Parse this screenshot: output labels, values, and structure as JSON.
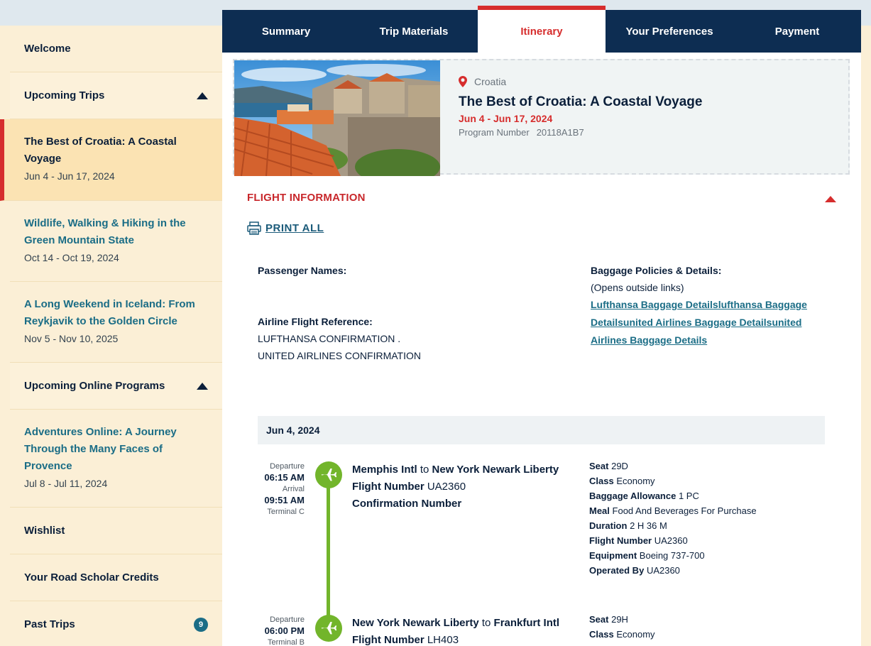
{
  "sidebar": {
    "welcome": "Welcome",
    "upcoming_trips": "Upcoming Trips",
    "trips": [
      {
        "title": "The Best of Croatia: A Coastal Voyage",
        "dates": "Jun 4 - Jun 17, 2024"
      },
      {
        "title": "Wildlife, Walking & Hiking in the Green Mountain State",
        "dates": "Oct 14 - Oct 19, 2024"
      },
      {
        "title": "A Long Weekend in Iceland: From Reykjavik to the Golden Circle",
        "dates": "Nov 5 - Nov 10, 2025"
      }
    ],
    "upcoming_online": "Upcoming Online Programs",
    "online": [
      {
        "title": "Adventures Online: A Journey Through the Many Faces of Provence",
        "dates": "Jul 8 - Jul 11, 2024"
      }
    ],
    "wishlist": "Wishlist",
    "credits": "Your Road Scholar Credits",
    "past_trips": "Past Trips",
    "past_count": "9"
  },
  "tabs": [
    "Summary",
    "Trip Materials",
    "Itinerary",
    "Your Preferences",
    "Payment"
  ],
  "card": {
    "location": "Croatia",
    "title": "The Best of Croatia: A Coastal Voyage",
    "dates": "Jun 4 - Jun 17, 2024",
    "program_label": "Program Number",
    "program_number": "20118A1B7"
  },
  "flight": {
    "heading": "FLIGHT INFORMATION",
    "print_all": "PRINT ALL",
    "passenger_label": "Passenger Names:",
    "reference_label": "Airline Flight Reference:",
    "references": [
      "LUFTHANSA CONFIRMATION .",
      "UNITED AIRLINES CONFIRMATION"
    ],
    "baggage_label": "Baggage Policies & Details:",
    "baggage_note": "(Opens outside links)",
    "baggage_link": "Lufthansa Baggage Detailslufthansa Baggage Detailsunited Airlines Baggage Detailsunited Airlines Baggage Details",
    "day": "Jun 4, 2024",
    "segments": [
      {
        "departure_label": "Departure",
        "departure_time": "06:15 AM",
        "arrival_label": "Arrival",
        "arrival_time": "09:51 AM",
        "terminal": "Terminal C",
        "from": "Memphis Intl",
        "to_word": "to",
        "to": "New York Newark Liberty",
        "flight_number_label": "Flight Number",
        "flight_number": "UA2360",
        "confirmation_label": "Confirmation Number",
        "seat_label": "Seat",
        "seat": "29D",
        "class_label": "Class",
        "class": "Economy",
        "baggage_label": "Baggage Allowance",
        "baggage": "1 PC",
        "meal_label": "Meal",
        "meal": "Food And Beverages For Purchase",
        "duration_label": "Duration",
        "duration": "2 H 36 M",
        "fn_label": "Flight Number",
        "fn": "UA2360",
        "equipment_label": "Equipment",
        "equipment": "Boeing 737-700",
        "operated_label": "Operated By",
        "operated": "UA2360"
      },
      {
        "departure_label": "Departure",
        "departure_time": "06:00 PM",
        "terminal": "Terminal B",
        "from": "New York Newark Liberty",
        "to_word": "to",
        "to": "Frankfurt Intl",
        "flight_number_label": "Flight Number",
        "flight_number": "LH403",
        "seat_label": "Seat",
        "seat": "29H",
        "class_label": "Class",
        "class": "Economy"
      }
    ]
  }
}
